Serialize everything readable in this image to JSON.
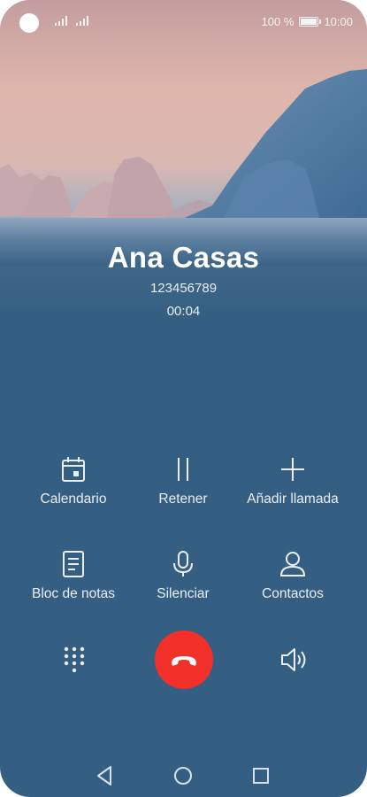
{
  "status_bar": {
    "battery": "100 %",
    "time": "10:00"
  },
  "call": {
    "contact_name": "Ana Casas",
    "phone_number": "123456789",
    "duration": "00:04"
  },
  "actions": {
    "row1": [
      {
        "label": "Calendario",
        "icon": "calendar-icon"
      },
      {
        "label": "Retener",
        "icon": "pause-icon"
      },
      {
        "label": "Añadir llamada",
        "icon": "plus-icon"
      }
    ],
    "row2": [
      {
        "label": "Bloc de notas",
        "icon": "notes-icon"
      },
      {
        "label": "Silenciar",
        "icon": "microphone-icon"
      },
      {
        "label": "Contactos",
        "icon": "person-icon"
      }
    ]
  },
  "controls": {
    "dialpad": "dialpad-icon",
    "end_call": "end-call-icon",
    "speaker": "speaker-icon"
  },
  "colors": {
    "background": "#355f82",
    "end_call": "#f2302a",
    "icon": "#e9eff5"
  }
}
